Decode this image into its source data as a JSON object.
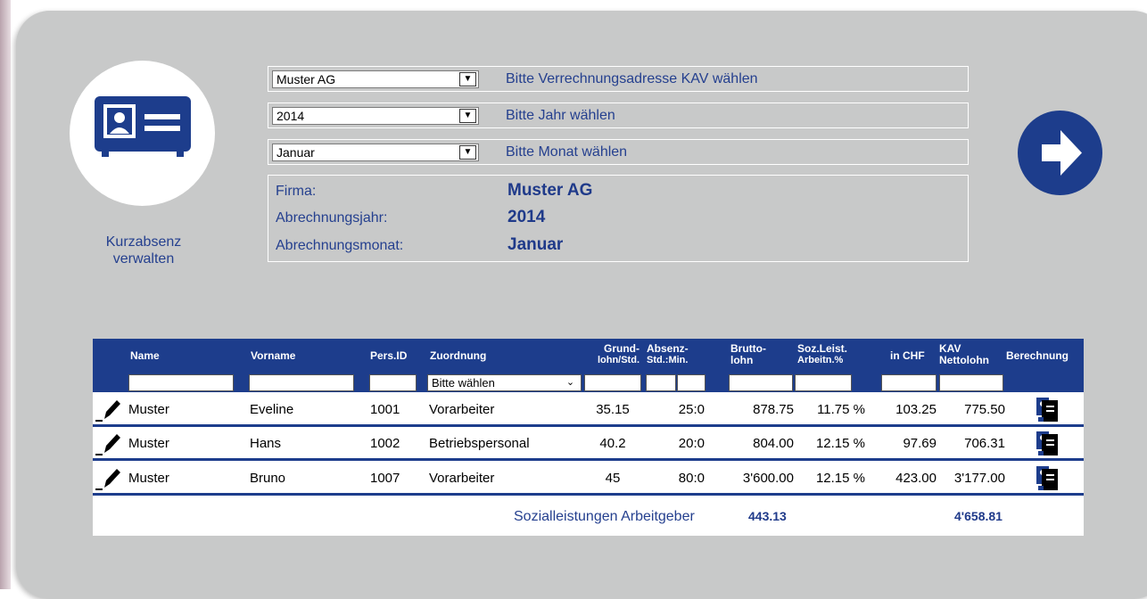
{
  "sidebar": {
    "title": "Kurzabsenz verwalten",
    "icon": "id-card-icon"
  },
  "selectors": [
    {
      "value": "Muster AG",
      "label": "Bitte Verrechnungsadresse KAV wählen"
    },
    {
      "value": "2014",
      "label": "Bitte Jahr wählen"
    },
    {
      "value": "Januar",
      "label": "Bitte Monat wählen"
    }
  ],
  "info": {
    "firma_label": "Firma:",
    "firma_value": "Muster AG",
    "jahr_label": "Abrechnungsjahr:",
    "jahr_value": "2014",
    "monat_label": "Abrechnungsmonat:",
    "monat_value": "Januar"
  },
  "next_button_icon": "arrow-right-icon",
  "table": {
    "headers": {
      "name": "Name",
      "vorname": "Vorname",
      "persid": "Pers.ID",
      "zuordnung": "Zuordnung",
      "grundlohn_1": "Grund-",
      "grundlohn_2": "lohn/Std.",
      "absenz_1": "Absenz-",
      "absenz_2": "Std.:Min.",
      "brutto_1": "Brutto-",
      "brutto_2": "lohn",
      "soz_1": "Soz.Leist.",
      "soz_2": "Arbeitn.%",
      "inchf": "in CHF",
      "kav_1": "KAV",
      "kav_2": "Nettolohn",
      "berechnung": "Berechnung"
    },
    "filter_select": "Bitte wählen",
    "rows": [
      {
        "name": "Muster",
        "vorname": "Eveline",
        "persid": "1001",
        "zuordnung": "Vorarbeiter",
        "grundlohn": "35.15",
        "absenz": "25:0",
        "brutto": "878.75",
        "soz": "11.75 %",
        "inchf": "103.25",
        "netto": "775.50"
      },
      {
        "name": "Muster",
        "vorname": "Hans",
        "persid": "1002",
        "zuordnung": "Betriebspersonal",
        "grundlohn": "40.2",
        "absenz": "20:0",
        "brutto": "804.00",
        "soz": "12.15 %",
        "inchf": "97.69",
        "netto": "706.31"
      },
      {
        "name": "Muster",
        "vorname": "Bruno",
        "persid": "1007",
        "zuordnung": "Vorarbeiter",
        "grundlohn": "45",
        "absenz": "80:0",
        "brutto": "3'600.00",
        "soz": "12.15 %",
        "inchf": "423.00",
        "netto": "3'177.00"
      }
    ],
    "footer": {
      "label": "Sozialleistungen Arbeitgeber",
      "amount": "443.13",
      "total": "4'658.81"
    }
  },
  "colors": {
    "accent": "#1d3d8c",
    "text_blue": "#25408f",
    "panel": "#c8c9c9"
  }
}
